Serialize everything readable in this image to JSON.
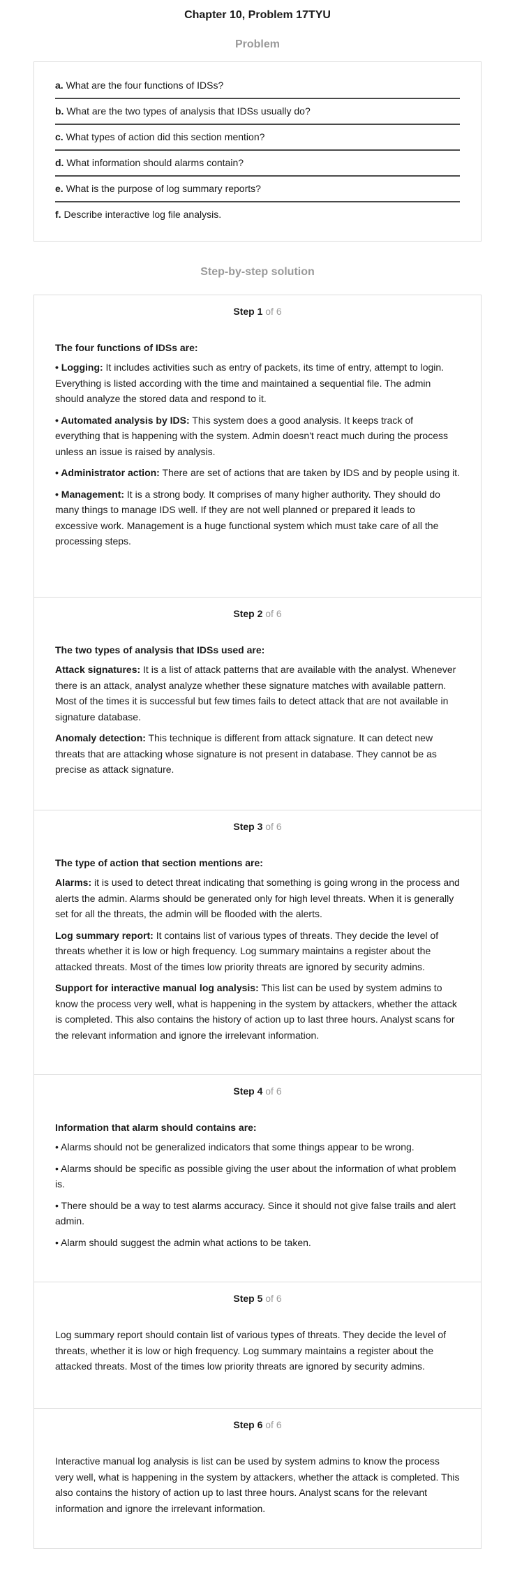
{
  "page_title": "Chapter 10, Problem 17TYU",
  "problem_heading": "Problem",
  "questions": [
    {
      "letter": "a.",
      "text": " What are the four functions of IDSs?"
    },
    {
      "letter": "b.",
      "text": " What are the two types of analysis that IDSs usually do?"
    },
    {
      "letter": "c.",
      "text": " What types of action did this section mention?"
    },
    {
      "letter": "d.",
      "text": " What information should alarms contain?"
    },
    {
      "letter": "e.",
      "text": " What is the purpose of log summary reports?"
    },
    {
      "letter": "f.",
      "text": " Describe interactive log file analysis."
    }
  ],
  "solution_heading": "Step-by-step solution",
  "steps": [
    {
      "label": "Step 1",
      "of": " of 6",
      "heading": "The four functions of IDSs are:",
      "paragraphs": [
        {
          "bold": "• Logging:",
          "text": " It includes activities such as entry of packets, its time of entry, attempt to login. Everything is listed according with the time and maintained a sequential file. The admin should analyze the stored data and respond to it."
        },
        {
          "bold": "• Automated analysis by IDS:",
          "text": " This system does a good analysis. It keeps track of everything that is happening with the system. Admin doesn't react much during the process unless an issue is raised by analysis."
        },
        {
          "bold": "• Administrator action:",
          "text": " There are set of actions that are taken by IDS and by people using it."
        },
        {
          "bold": "• Management:",
          "text": " It is a strong body. It comprises of many higher authority. They should do many things to manage IDS well. If they are not well planned or prepared it leads to excessive work. Management is a huge functional system which must take care of all the processing steps."
        }
      ]
    },
    {
      "label": "Step 2",
      "of": " of 6",
      "heading": "The two types of analysis that IDSs used are:",
      "paragraphs": [
        {
          "bold": "Attack signatures:",
          "text": " It is a list of attack patterns that are available with the analyst. Whenever there is an attack, analyst analyze whether these signature matches with available pattern. Most of the times it is successful but few times fails to detect attack that are not available in signature database."
        },
        {
          "bold": "Anomaly detection:",
          "text": " This technique is different from attack signature. It can detect new threats that are attacking whose signature is not present in database. They cannot be as precise as attack signature."
        }
      ]
    },
    {
      "label": "Step 3",
      "of": " of 6",
      "heading": "The type of action that section mentions are:",
      "paragraphs": [
        {
          "bold": "Alarms:",
          "text": " it is used to detect threat indicating that something is going wrong in the process and alerts the admin. Alarms should be generated only for high level threats. When it is generally set for all the threats, the admin will be flooded with the alerts."
        },
        {
          "bold": "Log summary report:",
          "text": " It contains list of various types of threats. They decide the level of threats whether it is low or high frequency. Log summary maintains a register about the attacked threats. Most of the times low priority threats are ignored by security admins."
        },
        {
          "bold": "Support for interactive manual log analysis:",
          "text": " This list can be used by system admins to know the process very well, what is happening in the system by attackers, whether the attack is completed. This also contains the history of action up to last three hours. Analyst scans for the relevant information and ignore the irrelevant information."
        }
      ]
    },
    {
      "label": "Step 4",
      "of": " of 6",
      "heading": "Information that alarm should contains are:",
      "paragraphs": [
        {
          "bold": "",
          "text": "• Alarms should not be generalized indicators that some things appear to be wrong."
        },
        {
          "bold": "",
          "text": "• Alarms should be specific as possible giving the user about the information of what problem is."
        },
        {
          "bold": "",
          "text": "• There should be a way to test alarms accuracy. Since it should not give false trails and alert admin."
        },
        {
          "bold": "",
          "text": "• Alarm should suggest the admin what actions to be taken."
        }
      ]
    },
    {
      "label": "Step 5",
      "of": " of 6",
      "heading": "",
      "paragraphs": [
        {
          "bold": "",
          "text": "Log summary report should contain list of various types of threats. They decide the level of threats, whether it is low or high frequency. Log summary maintains a register about the attacked threats. Most of the times low priority threats are ignored by security admins."
        }
      ]
    },
    {
      "label": "Step 6",
      "of": " of 6",
      "heading": "",
      "paragraphs": [
        {
          "bold": "",
          "text": "Interactive manual log analysis is list can be used by system admins to know the process very well, what is happening in the system by attackers, whether the attack is completed. This also contains the history of action up to last three hours. Analyst scans for the relevant information and ignore the irrelevant information."
        }
      ]
    }
  ]
}
